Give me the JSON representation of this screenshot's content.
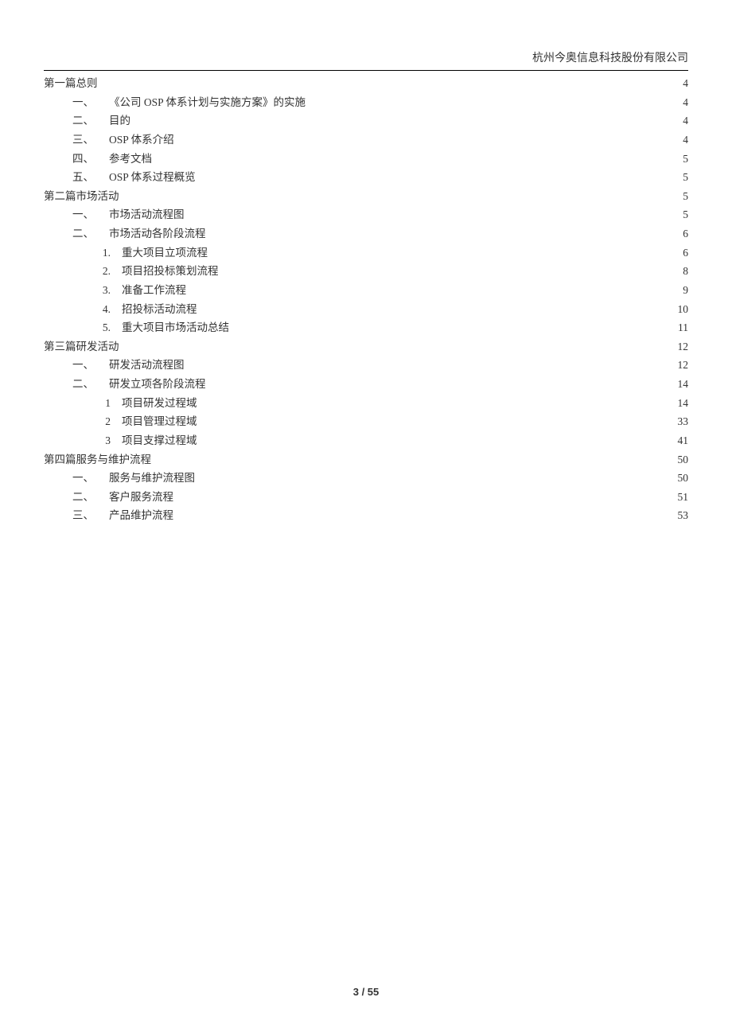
{
  "header": {
    "company": "杭州今奥信息科技股份有限公司"
  },
  "toc": [
    {
      "level": 0,
      "marker": "",
      "title": "第一篇总则",
      "page": "4"
    },
    {
      "level": 1,
      "marker": "一、",
      "title": "《公司 OSP 体系计划与实施方案》的实施",
      "page": "4"
    },
    {
      "level": 1,
      "marker": "二、",
      "title": "目的",
      "page": "4"
    },
    {
      "level": 1,
      "marker": "三、",
      "title": "OSP 体系介绍",
      "page": "4"
    },
    {
      "level": 1,
      "marker": "四、",
      "title": "参考文档",
      "page": "5"
    },
    {
      "level": 1,
      "marker": "五、",
      "title": "OSP 体系过程概览",
      "page": "5"
    },
    {
      "level": 0,
      "marker": "",
      "title": "第二篇市场活动",
      "page": "5"
    },
    {
      "level": 1,
      "marker": "一、",
      "title": "市场活动流程图",
      "page": "5"
    },
    {
      "level": 1,
      "marker": "二、",
      "title": "市场活动各阶段流程",
      "page": "6"
    },
    {
      "level": 2,
      "marker": "1.",
      "title": "重大项目立项流程",
      "page": "6"
    },
    {
      "level": 2,
      "marker": "2.",
      "title": "项目招投标策划流程",
      "page": "8"
    },
    {
      "level": 2,
      "marker": "3.",
      "title": "准备工作流程",
      "page": "9"
    },
    {
      "level": 2,
      "marker": "4.",
      "title": "招投标活动流程",
      "page": "10"
    },
    {
      "level": 2,
      "marker": "5.",
      "title": "重大项目市场活动总结",
      "page": "11"
    },
    {
      "level": 0,
      "marker": "",
      "title": "第三篇研发活动",
      "page": "12"
    },
    {
      "level": 1,
      "marker": "一、",
      "title": "研发活动流程图",
      "page": "12"
    },
    {
      "level": 1,
      "marker": "二、",
      "title": "研发立项各阶段流程",
      "page": "14"
    },
    {
      "level": 2,
      "marker": "1",
      "title": "项目研发过程域",
      "page": "14"
    },
    {
      "level": 2,
      "marker": "2",
      "title": "项目管理过程域",
      "page": "33"
    },
    {
      "level": 2,
      "marker": "3",
      "title": "项目支撑过程域",
      "page": "41"
    },
    {
      "level": 0,
      "marker": "",
      "title": "第四篇服务与维护流程",
      "page": "50"
    },
    {
      "level": 1,
      "marker": "一、",
      "title": "服务与维护流程图",
      "page": "50"
    },
    {
      "level": 1,
      "marker": "二、",
      "title": "客户服务流程",
      "page": "51"
    },
    {
      "level": 1,
      "marker": "三、",
      "title": "产品维护流程",
      "page": "53"
    }
  ],
  "footer": {
    "page_label": "3 / 55"
  }
}
